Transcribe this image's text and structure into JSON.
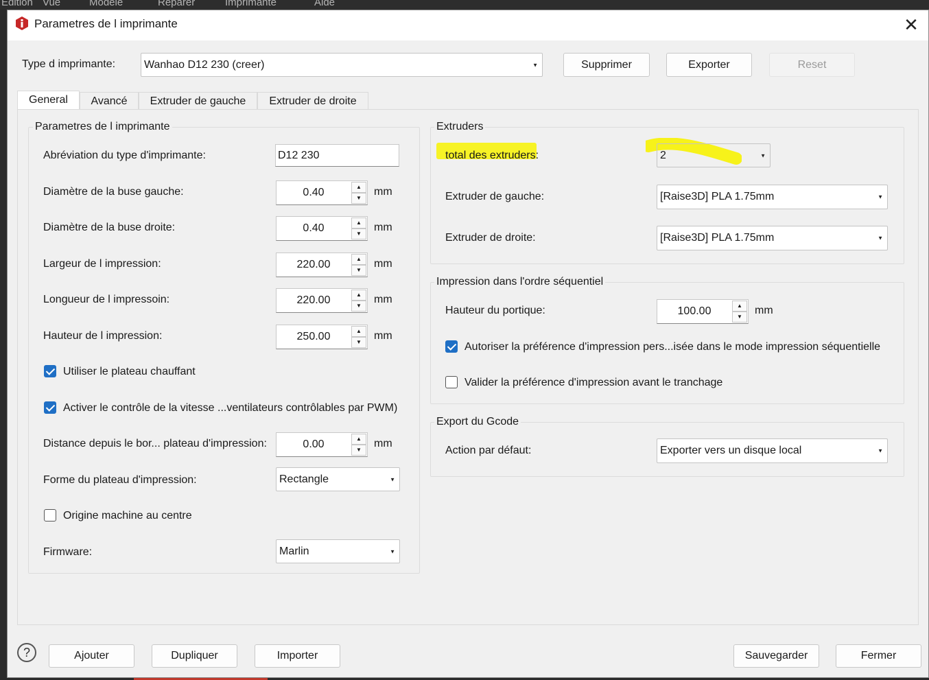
{
  "background_menu": [
    "Edition",
    "Vue",
    "Modèle",
    "Reparer",
    "Imprimante",
    "Aide"
  ],
  "dialog": {
    "title": "Parametres de l imprimante",
    "close_glyph": "✕"
  },
  "top_bar": {
    "type_label": "Type d imprimante:",
    "type_value": "Wanhao D12 230 (creer)",
    "delete_label": "Supprimer",
    "export_label": "Exporter",
    "reset_label": "Reset"
  },
  "tabs": [
    "General",
    "Avancé",
    "Extruder de gauche",
    "Extruder de droite"
  ],
  "printer_params": {
    "title": "Parametres de l imprimante",
    "abbr_label": "Abréviation du type d'imprimante:",
    "abbr_value": "D12 230",
    "nozzle_left_label": "Diamètre de la buse gauche:",
    "nozzle_left_value": "0.40",
    "nozzle_right_label": "Diamètre de la buse droite:",
    "nozzle_right_value": "0.40",
    "width_label": "Largeur de l impression:",
    "width_value": "220.00",
    "length_label": "Longueur de l impressoin:",
    "length_value": "220.00",
    "height_label": "Hauteur de l impression:",
    "height_value": "250.00",
    "heated_bed_label": "Utiliser le plateau chauffant",
    "heated_bed_checked": true,
    "fan_control_label": "Activer le contrôle de la vitesse ...ventilateurs contrôlables par PWM)",
    "fan_control_checked": true,
    "edge_distance_label": "Distance depuis le bor... plateau d'impression:",
    "edge_distance_value": "0.00",
    "bed_shape_label": "Forme du plateau d'impression:",
    "bed_shape_value": "Rectangle",
    "origin_center_label": "Origine machine au centre",
    "origin_center_checked": false,
    "firmware_label": "Firmware:",
    "firmware_value": "Marlin",
    "unit": "mm"
  },
  "extruders": {
    "title": "Extruders",
    "total_label": "total des extruders",
    "total_colon": ":",
    "total_value": "2",
    "left_label": "Extruder de gauche:",
    "left_value": "[Raise3D] PLA 1.75mm",
    "right_label": "Extruder de droite:",
    "right_value": "[Raise3D] PLA 1.75mm",
    "highlight_color": "#f7f21a"
  },
  "sequential": {
    "title": "Impression dans l'ordre séquentiel",
    "gantry_label": "Hauteur du portique:",
    "gantry_value": "100.00",
    "unit": "mm",
    "allow_custom_label": "Autoriser la préférence d'impression pers...isée dans le mode impression séquentielle",
    "allow_custom_checked": true,
    "validate_label": "Valider la préférence d'impression avant le tranchage",
    "validate_checked": false
  },
  "gcode_export": {
    "title": "Export du Gcode",
    "default_action_label": "Action par défaut:",
    "default_action_value": "Exporter vers un disque local"
  },
  "footer": {
    "help_glyph": "?",
    "add_label": "Ajouter",
    "duplicate_label": "Dupliquer",
    "import_label": "Importer",
    "save_label": "Sauvegarder",
    "close_label": "Fermer"
  },
  "colors": {
    "checkbox_accent": "#1f6fc5",
    "app_icon": "#c62828"
  },
  "icons": {
    "app": "app-logo-icon",
    "close": "close-icon",
    "dropdown": "chevron-down-icon",
    "spin_up": "spin-up-icon",
    "spin_down": "spin-down-icon",
    "help": "help-icon"
  }
}
